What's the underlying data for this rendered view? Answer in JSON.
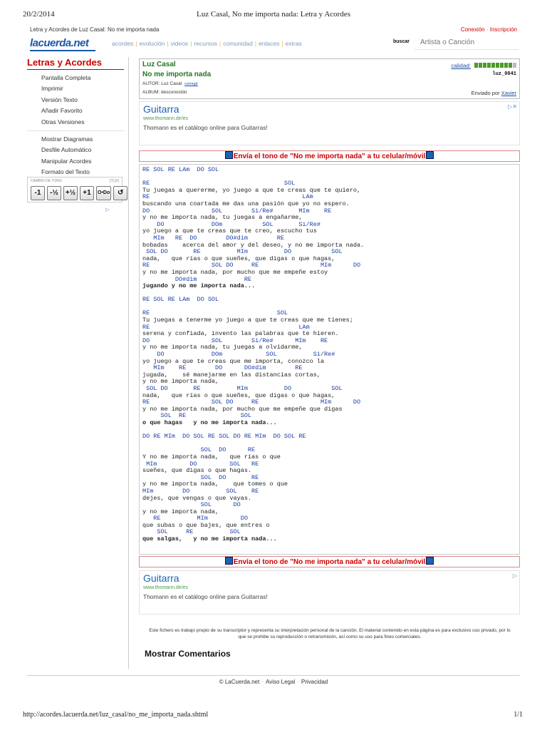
{
  "print_header": {
    "date": "20/2/2014",
    "title": "Luz Casal, No me importa nada: Letra y Acordes"
  },
  "subheader": {
    "breadcrumb": "Letra y Acordes de Luz Casal: No me importa nada",
    "login": "Conexión",
    "register": "Inscripción"
  },
  "logo": {
    "text": "lacuerda.net"
  },
  "topnav": {
    "items": [
      "acordes",
      "evolución",
      "videos",
      "recursos",
      "comunidad",
      "enlaces",
      "extras"
    ]
  },
  "search": {
    "label": "buscar",
    "placeholder": "Artista o Canción"
  },
  "sidebar": {
    "title": "Letras y Acordes",
    "group1": [
      "Pantalla Completa",
      "Imprimir",
      "Versión Texto",
      "Añadir Favorito",
      "Otras Versiones"
    ],
    "group2": [
      "Mostrar Diagramas",
      "Desfile Automático",
      "Manipular Acordes",
      "Formato del Texto"
    ],
    "transpose": {
      "caption": "CAMBIO DE TONO",
      "help": "[?] [X]",
      "buttons": [
        "-1",
        "-½",
        "+½",
        "+1",
        "O•Do",
        "↺"
      ]
    }
  },
  "song": {
    "artist": "Luz Casal",
    "title": "No me importa nada",
    "author_label": "AUTOR: Luz Casal",
    "fix_label": "corregir",
    "album_label": "ALBUM: desconocido",
    "quality_label": "calidad:",
    "quality_level": 0.9,
    "user": "luz_0041",
    "sent_by_label": "Enviado por",
    "sent_by_user": "Xavier"
  },
  "ads": {
    "ad1": {
      "headline": "Guitarra",
      "url": "www.thomann.de/es",
      "desc": "Thomann es el catálogo online para Guitarras!",
      "choice": "▷✕"
    },
    "ad2": {
      "headline": "Guitarra",
      "url": "www.thomann.de/es",
      "desc": "Thomann es el catálogo online para Guitarras!",
      "choice": "▷"
    }
  },
  "tone_banner": {
    "text": "Envía el tono de \"No me importa nada\" a tu celular/móvil"
  },
  "chord_lines": [
    {
      "t": "c",
      "s": "RE SOL RE LAm  DO SOL"
    },
    {
      "t": "l",
      "s": ""
    },
    {
      "t": "c",
      "s": "RE                                     SOL"
    },
    {
      "t": "l",
      "s": "Tu juegas a quererme, yo juego a que te creas que te quiero,"
    },
    {
      "t": "c",
      "s": "RE                                          LAm"
    },
    {
      "t": "l",
      "s": "buscando una coartada me das una pasión que yo no espero."
    },
    {
      "t": "c",
      "s": "DO                 SOL        Si/Re#       MIm    RE"
    },
    {
      "t": "l",
      "s": "y no me importa nada, tu juegas a engañarme,"
    },
    {
      "t": "c",
      "s": "    DO             DOm           SOL       Si/Re#"
    },
    {
      "t": "l",
      "s": "yo juego a que te creas que te creo, escucho tus"
    },
    {
      "t": "c",
      "s": "   MIm   RE  DO        DO#dim        RE"
    },
    {
      "t": "l",
      "s": "bobadas    acerca del amor y del deseo, y no me importa nada."
    },
    {
      "t": "c",
      "s": " SOL DO       RE          MIm          DO           SOL"
    },
    {
      "t": "l",
      "s": "nada,   que rías o que sueñes, que digas o que hagas,"
    },
    {
      "t": "c",
      "s": "RE                 SOL DO     RE                 MIm      DO"
    },
    {
      "t": "l",
      "s": "y no me importa nada, por mucho que me empeñe estoy"
    },
    {
      "t": "c",
      "s": "         DO#dim             RE"
    },
    {
      "t": "b",
      "s": "jugando y no me importa nada..."
    },
    {
      "t": "l",
      "s": ""
    },
    {
      "t": "c",
      "s": "RE SOL RE LAm  DO SOL"
    },
    {
      "t": "l",
      "s": ""
    },
    {
      "t": "c",
      "s": "RE                                   SOL"
    },
    {
      "t": "l",
      "s": "Tu juegas a tenerme yo juego a que te creas que me tienes;"
    },
    {
      "t": "c",
      "s": "RE                                         LAm"
    },
    {
      "t": "l",
      "s": "serena y confiada, invento las palabras que te hieren."
    },
    {
      "t": "c",
      "s": "DO                 SOL        Si/Re#      MIm    RE"
    },
    {
      "t": "l",
      "s": "y no me importa nada, tu juegas a olvidarme,"
    },
    {
      "t": "c",
      "s": "    DO             DOm            SOL          Si/Re#"
    },
    {
      "t": "l",
      "s": "yo juego a que te creas que me importa, conozco la"
    },
    {
      "t": "c",
      "s": "   MIm    RE        DO      DO#dim        RE"
    },
    {
      "t": "l",
      "s": "jugada,    sé manejarme en las distancias cortas,"
    },
    {
      "t": "l",
      "s": "y no me importa nada,"
    },
    {
      "t": "c",
      "s": " SOL DO       RE          MIm          DO           SOL"
    },
    {
      "t": "l",
      "s": "nada,   que rías o que sueñes, que digas o que hagas,"
    },
    {
      "t": "c",
      "s": "RE                 SOL DO     RE                 MIm      DO"
    },
    {
      "t": "l",
      "s": "y no me importa nada, por mucho que me empeñe que digas"
    },
    {
      "t": "c",
      "s": "     SOL  RE               SOL"
    },
    {
      "t": "b",
      "s": "o que hagas   y no me importa nada..."
    },
    {
      "t": "l",
      "s": ""
    },
    {
      "t": "c",
      "s": "DO RE MIm  DO SOL RE SOL DO RE MIm  DO SOL RE"
    },
    {
      "t": "l",
      "s": ""
    },
    {
      "t": "c",
      "s": "                SOL  DO      RE"
    },
    {
      "t": "l",
      "s": "Y no me importa nada,   que rías o que"
    },
    {
      "t": "c",
      "s": " MIm         DO         SOL   RE"
    },
    {
      "t": "l",
      "s": "sueñes, que digas o que hagas."
    },
    {
      "t": "c",
      "s": "                SOL  DO       RE"
    },
    {
      "t": "l",
      "s": "y no me importa nada,    que tomes o que"
    },
    {
      "t": "c",
      "s": "MIm        DO          SOL    RE"
    },
    {
      "t": "l",
      "s": "dejes, que vengas o que vayas."
    },
    {
      "t": "c",
      "s": "                SOL      DO"
    },
    {
      "t": "l",
      "s": "y no me importa nada,"
    },
    {
      "t": "c",
      "s": "   RE          MIm         DO"
    },
    {
      "t": "l",
      "s": "que subas o que bajes, que entres o"
    },
    {
      "t": "c",
      "s": "    SOL     RE          SOL"
    },
    {
      "t": "b",
      "s": "que salgas,   y no me importa nada..."
    }
  ],
  "disclaimer": "Este fichero es trabajo propio de su transcriptor y representa su interpretación personal de la canción. El material contenido en esta página es para exclusivo uso privado, por lo que se prohibe su reproducción o retransmisión, así como su uso para fines comerciales.",
  "comments_label": "Mostrar Comentarios",
  "footer": {
    "brand": "© LaCuerda.net",
    "legal": "Aviso Legal",
    "privacy": "Privacidad"
  },
  "print_footer": {
    "url": "http://acordes.lacuerda.net/luz_casal/no_me_importa_nada.shtml",
    "page": "1/1"
  }
}
